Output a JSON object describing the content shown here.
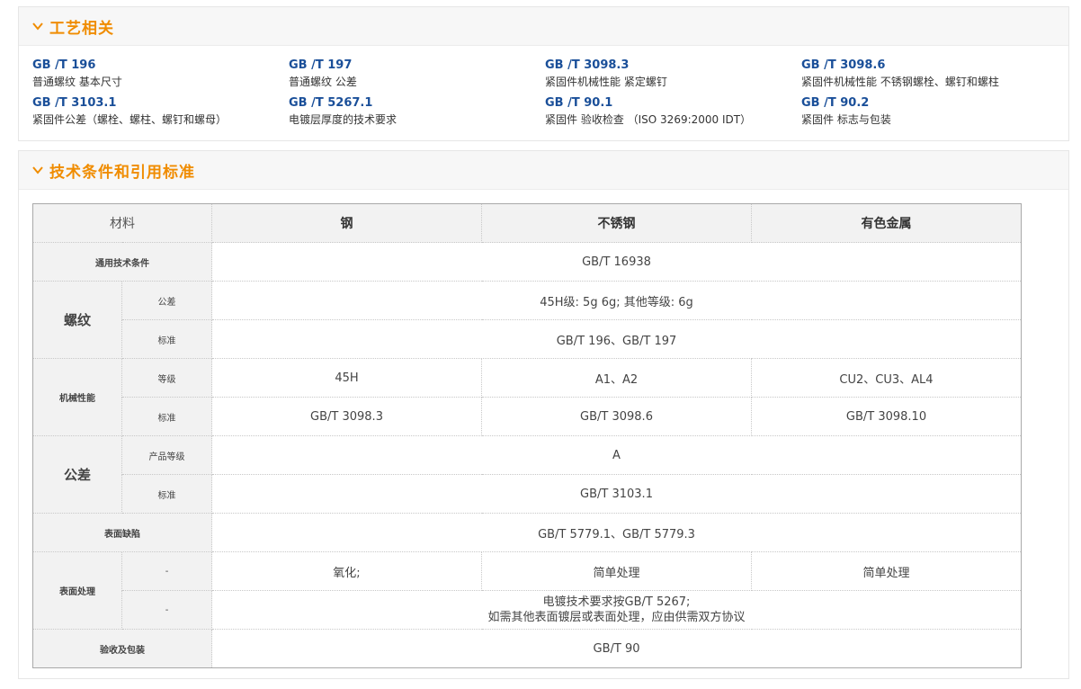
{
  "section1": {
    "title": "工艺相关",
    "standards": [
      {
        "code": "GB /T 196",
        "name": "普通螺纹 基本尺寸"
      },
      {
        "code": "GB /T 197",
        "name": "普通螺纹 公差"
      },
      {
        "code": "GB /T 3098.3",
        "name": "紧固件机械性能 紧定螺钉"
      },
      {
        "code": "GB /T 3098.6",
        "name": "紧固件机械性能 不锈钢螺栓、螺钉和螺柱"
      },
      {
        "code": "GB /T 3103.1",
        "name": "紧固件公差（螺栓、螺柱、螺钉和螺母）"
      },
      {
        "code": "GB /T 5267.1",
        "name": "电镀层厚度的技术要求"
      },
      {
        "code": "GB /T 90.1",
        "name": "紧固件 验收检查 （ISO 3269:2000 IDT）"
      },
      {
        "code": "GB /T 90.2",
        "name": "紧固件 标志与包装"
      }
    ]
  },
  "section2": {
    "title": "技术条件和引用标准",
    "header": {
      "material": "材料",
      "col1": "钢",
      "col2": "不锈钢",
      "col3": "有色金属"
    },
    "rows": {
      "general": {
        "label": "通用技术条件",
        "value": "GB/T 16938"
      },
      "thread": {
        "label": "螺纹",
        "tol_label": "公差",
        "tol_value": "45H级: 5g 6g; 其他等级: 6g",
        "std_label": "标准",
        "std_value": "GB/T 196、GB/T 197"
      },
      "mech": {
        "label": "机械性能",
        "grade_label": "等级",
        "grade": [
          "45H",
          "A1、A2",
          "CU2、CU3、AL4"
        ],
        "std_label": "标准",
        "std": [
          "GB/T 3098.3",
          "GB/T 3098.6",
          "GB/T 3098.10"
        ]
      },
      "tolerance": {
        "label": "公差",
        "grade_label": "产品等级",
        "grade_value": "A",
        "std_label": "标准",
        "std_value": "GB/T 3103.1"
      },
      "defects": {
        "label": "表面缺陷",
        "value": "GB/T 5779.1、GB/T 5779.3"
      },
      "surface": {
        "label": "表面处理",
        "sub1": "-",
        "values": [
          "氧化;",
          "简单处理",
          "简单处理"
        ],
        "sub2": "-",
        "line1": "电镀技术要求按GB/T 5267;",
        "line2": "如需其他表面镀层或表面处理，应由供需双方协议"
      },
      "acceptance": {
        "label": "验收及包装",
        "value": "GB/T 90"
      }
    }
  },
  "colors": {
    "accent": "#f08c00",
    "link": "#1a4f99",
    "header_bg": "#f2f2f2"
  }
}
